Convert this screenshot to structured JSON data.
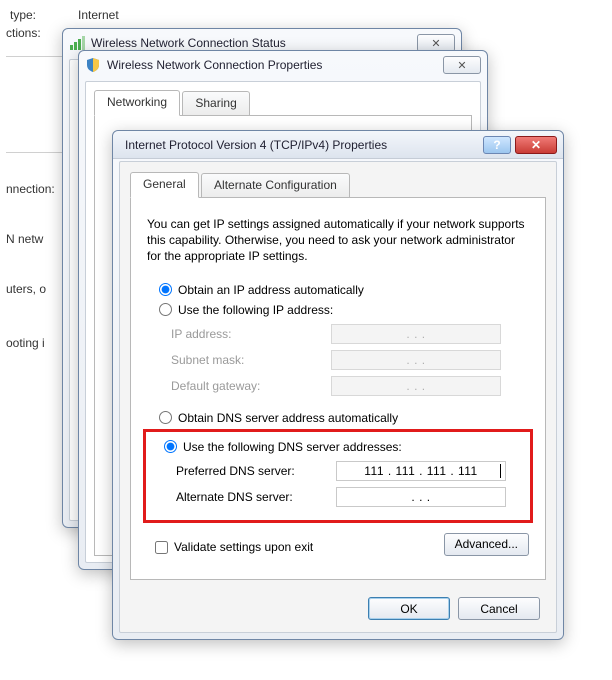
{
  "background": {
    "type_label": "type:",
    "type_value": "Internet",
    "connections_label": "ctions:",
    "connection_label_fragment": "nnection:",
    "network_label_fragment": "N netw",
    "routers_fragment": "uters, o",
    "troubleshoot_fragment": "ooting i"
  },
  "status_window": {
    "title": "Wireless Network Connection Status"
  },
  "properties_window": {
    "title": "Wireless Network Connection Properties",
    "tabs": {
      "networking": "Networking",
      "sharing": "Sharing"
    }
  },
  "ipv4_window": {
    "title": "Internet Protocol Version 4 (TCP/IPv4) Properties",
    "tabs": {
      "general": "General",
      "alt": "Alternate Configuration"
    },
    "description": "You can get IP settings assigned automatically if your network supports this capability. Otherwise, you need to ask your network administrator for the appropriate IP settings.",
    "ip_auto": "Obtain an IP address automatically",
    "ip_manual": "Use the following IP address:",
    "ip_addr_label": "IP address:",
    "subnet_label": "Subnet mask:",
    "gateway_label": "Default gateway:",
    "dns_auto": "Obtain DNS server address automatically",
    "dns_manual": "Use the following DNS server addresses:",
    "pref_dns_label": "Preferred DNS server:",
    "alt_dns_label": "Alternate DNS server:",
    "pref_dns_value": "111 . 111 . 111 . 111",
    "alt_dns_value": ".        .        .",
    "empty_ip": ".        .        .",
    "validate": "Validate settings upon exit",
    "advanced": "Advanced...",
    "ok": "OK",
    "cancel": "Cancel"
  }
}
